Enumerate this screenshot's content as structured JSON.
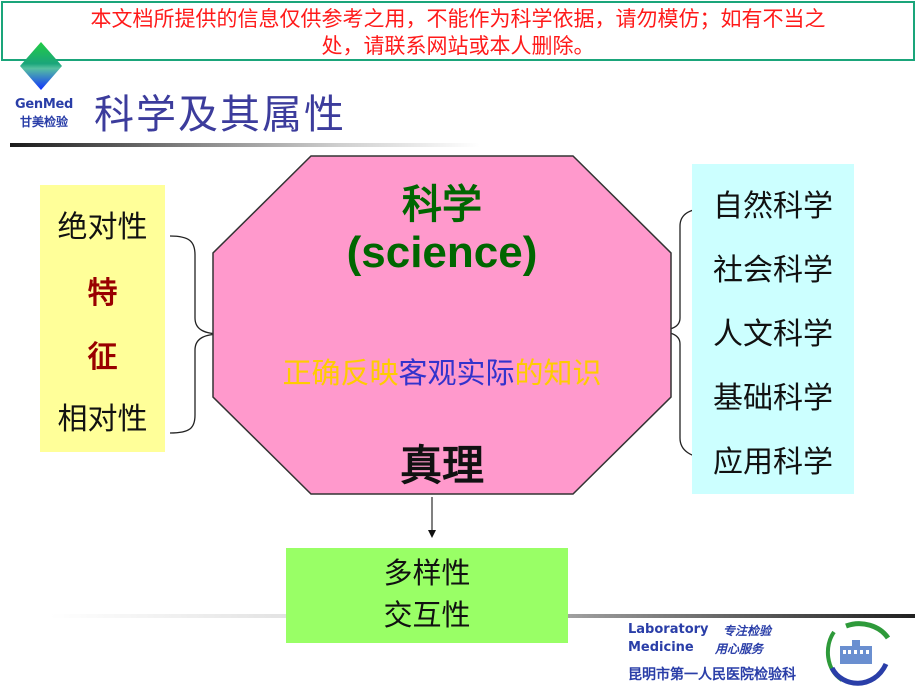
{
  "disclaimer": {
    "line1": "本文档所提供的信息仅供参考之用，不能作为科学依据，请勿模仿；如有不当之",
    "line2": "处，请联系网站或本人删除。",
    "color": "#ff1a1a",
    "border_color": "#1aa57a"
  },
  "logo": {
    "name_en": "GenMed",
    "name_cn": "甘美检验",
    "icon": "diamond-logo-icon"
  },
  "page_title": "科学及其属性",
  "features": {
    "items": [
      {
        "text": "绝对性",
        "style": "normal"
      },
      {
        "text": "特",
        "style": "highlight"
      },
      {
        "text": "征",
        "style": "highlight"
      },
      {
        "text": "相对性",
        "style": "normal"
      }
    ],
    "background": "#ffff99"
  },
  "center": {
    "title": "科学",
    "subtitle": "(science)",
    "definition": {
      "part1": "正确反映",
      "part2": "客观实际",
      "part3": "的知识"
    },
    "truth": "真理",
    "background": "#ff99cc"
  },
  "science_types": {
    "items": [
      "自然科学",
      "社会科学",
      "人文科学",
      "基础科学",
      "应用科学"
    ],
    "background": "#ccffff"
  },
  "properties": {
    "items": [
      "多样性",
      "交互性"
    ],
    "background": "#99ff66"
  },
  "footer": {
    "line1_en": "Laboratory",
    "line1_slogan": "专注检验",
    "line2_en": "Medicine",
    "line2_slogan": "用心服务",
    "department": "昆明市第一人民医院检验科",
    "emblem": "hospital-emblem-icon"
  }
}
